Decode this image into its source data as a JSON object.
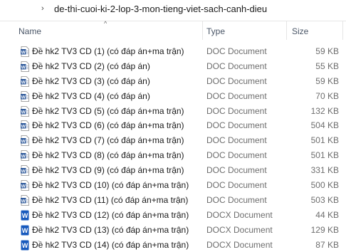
{
  "address_bar": {
    "chevron": "›",
    "path": "de-thi-cuoi-ki-2-lop-3-mon-tieng-viet-sach-canh-dieu"
  },
  "header": {
    "sort_arrow": "^",
    "name": "Name",
    "type": "Type",
    "size": "Size"
  },
  "files": [
    {
      "name": "Đề hk2 TV3 CD (1) (có đáp án+ma trận)",
      "type": "DOC Document",
      "size": "59 KB",
      "icon": "word-doc-icon"
    },
    {
      "name": "Đề hk2 TV3 CD (2) (có đáp án)",
      "type": "DOC Document",
      "size": "55 KB",
      "icon": "word-doc-icon"
    },
    {
      "name": "Đề hk2 TV3 CD (3) (có đáp án)",
      "type": "DOC Document",
      "size": "59 KB",
      "icon": "word-doc-icon"
    },
    {
      "name": "Đề hk2 TV3 CD (4) (có đáp án)",
      "type": "DOC Document",
      "size": "70 KB",
      "icon": "word-doc-icon"
    },
    {
      "name": "Đề hk2 TV3 CD (5) (có đáp án+ma trận)",
      "type": "DOC Document",
      "size": "132 KB",
      "icon": "word-doc-icon"
    },
    {
      "name": "Đề hk2 TV3 CD (6) (có đáp án+ma trận)",
      "type": "DOC Document",
      "size": "504 KB",
      "icon": "word-doc-icon"
    },
    {
      "name": "Đề hk2 TV3 CD (7) (có đáp án+ma trận)",
      "type": "DOC Document",
      "size": "501 KB",
      "icon": "word-doc-icon"
    },
    {
      "name": "Đề hk2 TV3 CD (8) (có đáp án+ma trận)",
      "type": "DOC Document",
      "size": "501 KB",
      "icon": "word-doc-icon"
    },
    {
      "name": "Đề hk2 TV3 CD (9) (có đáp án+ma trận)",
      "type": "DOC Document",
      "size": "331 KB",
      "icon": "word-doc-icon"
    },
    {
      "name": "Đề hk2 TV3 CD (10) (có đáp án+ma trận)",
      "type": "DOC Document",
      "size": "500 KB",
      "icon": "word-doc-icon"
    },
    {
      "name": "Đề hk2 TV3 CD (11) (có đáp án+ma trận)",
      "type": "DOC Document",
      "size": "503 KB",
      "icon": "word-doc-icon"
    },
    {
      "name": "Đề hk2 TV3 CD (12) (có đáp án+ma trận)",
      "type": "DOCX Document",
      "size": "44 KB",
      "icon": "word-docx-icon"
    },
    {
      "name": "Đề hk2 TV3 CD (13) (có đáp án+ma trận)",
      "type": "DOCX Document",
      "size": "129 KB",
      "icon": "word-docx-icon"
    },
    {
      "name": "Đề hk2 TV3 CD (14) (có đáp án+ma trận)",
      "type": "DOCX Document",
      "size": "87 KB",
      "icon": "word-docx-icon"
    }
  ],
  "colors": {
    "doc_icon_blue": "#2b579a",
    "docx_icon_blue": "#185abd"
  }
}
